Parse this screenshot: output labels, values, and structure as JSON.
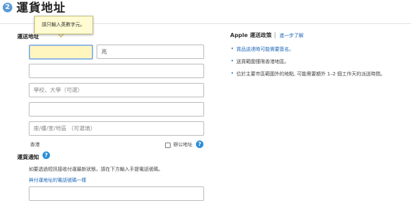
{
  "header": {
    "step_number": "2",
    "title": "運貨地址"
  },
  "form": {
    "section_label": "運送地址",
    "tooltip_text": "請只輸入英數字元。",
    "first_name_value": "",
    "last_name_value": "兆",
    "address_line1_value": "",
    "address_line2_placeholder": "學校，大學（可選）",
    "address_line3_value": "",
    "address_line4_placeholder": "座/樓/室/地區 （可選填）",
    "region_label": "香港",
    "office_checkbox_label": "辦公地址",
    "office_checked": false,
    "notify_label": "運貨通知",
    "notify_desc": "如要透過短訊接收付運最新狀態，請在下方輸入手提電話號碼。",
    "same_phone_link": "與付運地址的電話號碼一樣",
    "phone_value": ""
  },
  "policy": {
    "title": "Apple 運送政策",
    "learn_more": "進一步了解",
    "items": [
      "貨品送達時可能需要簽名。",
      "送貨範圍僅限香港地區。",
      "位於主要市區範圍外的地點, 可能需要額外 1–2 個工作天的派送時間。"
    ]
  },
  "colors": {
    "accent": "#2c8ed8",
    "link": "#1a66b8",
    "highlight_field": "#fff6bf",
    "tooltip_bg": "#fffbd2"
  }
}
